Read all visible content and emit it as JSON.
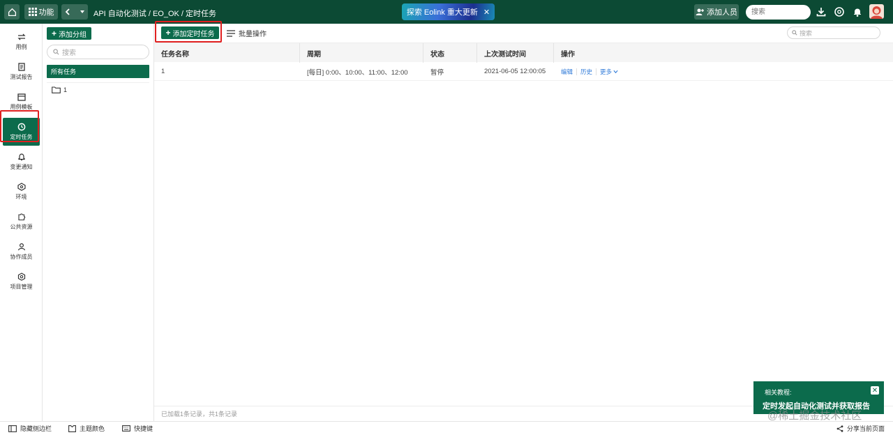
{
  "topbar": {
    "function_label": "功能",
    "breadcrumb": "API 自动化测试  / EO_OK / 定时任务",
    "banner_text": "探索 Eolink 重大更新",
    "banner_close": "✕",
    "add_member_label": "添加人员",
    "search_placeholder": "搜索"
  },
  "leftnav": {
    "items": [
      {
        "label": "用例"
      },
      {
        "label": "测试报告"
      },
      {
        "label": "用例模板"
      },
      {
        "label": "定时任务"
      },
      {
        "label": "变更通知"
      },
      {
        "label": "环境"
      },
      {
        "label": "公共资源"
      },
      {
        "label": "协作成员"
      },
      {
        "label": "项目管理"
      }
    ]
  },
  "grouppanel": {
    "add_group_label": "添加分组",
    "search_placeholder": "搜索",
    "all_tasks_label": "所有任务",
    "folders": [
      {
        "label": "1"
      }
    ]
  },
  "main": {
    "add_task_label": "添加定时任务",
    "batch_label": "批量操作",
    "search_placeholder": "搜索",
    "columns": [
      "任务名称",
      "周期",
      "状态",
      "上次测试时间",
      "操作"
    ],
    "rows": [
      {
        "name": "1",
        "cycle": "[每日]  0:00、10:00、11:00、12:00",
        "status": "暂停",
        "last_test": "2021-06-05 12:00:05",
        "ops": {
          "edit": "编辑",
          "history": "历史",
          "more": "更多"
        }
      }
    ],
    "footer": "已加载1条记录，共1条记录"
  },
  "bottombar": {
    "hide_sidebar": "隐藏侧边栏",
    "theme_color": "主题颜色",
    "shortcuts": "快捷键",
    "share": "分享当前页面"
  },
  "tutorial": {
    "label": "相关教程:",
    "title": "定时发起自动化测试并获取报告",
    "close": "✕"
  },
  "watermark": "@稀土掘金技术社区",
  "colors": {
    "brand_dark": "#0c4a34",
    "brand": "#0c6b4c",
    "highlight": "#e02020",
    "link": "#2f7ad8"
  }
}
